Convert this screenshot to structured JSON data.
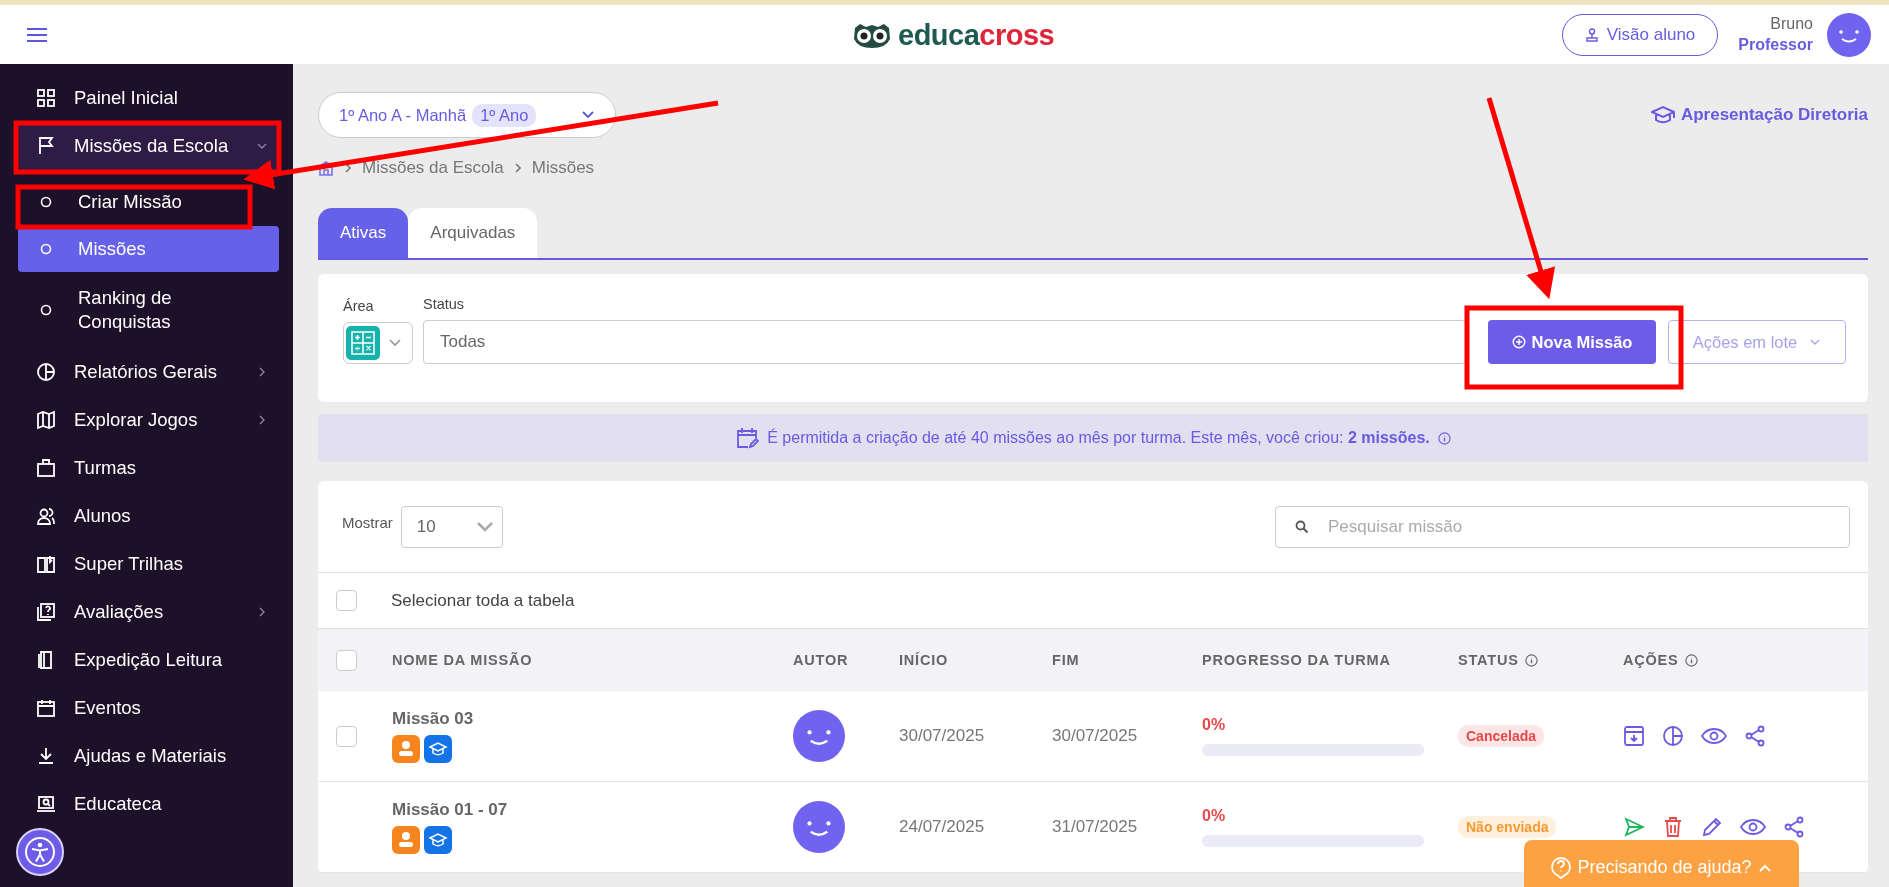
{
  "header": {
    "logo_prefix": "educa",
    "logo_suffix": "cross",
    "student_view": "Visão aluno",
    "user_name": "Bruno",
    "user_role": "Professor"
  },
  "sidebar": {
    "items": [
      {
        "label": "Painel Inicial",
        "kind": "item",
        "selected": false,
        "expanded": false,
        "has_submenu": false
      },
      {
        "label": "Missões da Escola",
        "kind": "item",
        "selected": false,
        "expanded": true,
        "has_submenu": true
      },
      {
        "label": "Criar Missão",
        "kind": "subitem",
        "selected": false,
        "expanded": false,
        "has_submenu": false
      },
      {
        "label": "Missões",
        "kind": "subitem",
        "selected": true,
        "expanded": false,
        "has_submenu": false
      },
      {
        "label": "Ranking de Conquistas",
        "kind": "subitem",
        "selected": false,
        "expanded": false,
        "has_submenu": false
      },
      {
        "label": "Relatórios Gerais",
        "kind": "item",
        "selected": false,
        "expanded": false,
        "has_submenu": true
      },
      {
        "label": "Explorar Jogos",
        "kind": "item",
        "selected": false,
        "expanded": false,
        "has_submenu": true
      },
      {
        "label": "Turmas",
        "kind": "item",
        "selected": false,
        "expanded": false,
        "has_submenu": false
      },
      {
        "label": "Alunos",
        "kind": "item",
        "selected": false,
        "expanded": false,
        "has_submenu": false
      },
      {
        "label": "Super Trilhas",
        "kind": "item",
        "selected": false,
        "expanded": false,
        "has_submenu": false
      },
      {
        "label": "Avaliações",
        "kind": "item",
        "selected": false,
        "expanded": false,
        "has_submenu": true
      },
      {
        "label": "Expedição Leitura",
        "kind": "item",
        "selected": false,
        "expanded": false,
        "has_submenu": false
      },
      {
        "label": "Eventos",
        "kind": "item",
        "selected": false,
        "expanded": false,
        "has_submenu": false
      },
      {
        "label": "Ajudas e Materiais",
        "kind": "item",
        "selected": false,
        "expanded": false,
        "has_submenu": false
      },
      {
        "label": "Educateca",
        "kind": "item",
        "selected": false,
        "expanded": false,
        "has_submenu": false
      }
    ]
  },
  "class_selector": {
    "value": "1º Ano A - Manhã",
    "badge": "1º Ano"
  },
  "presentation_link": "Apresentação Diretoria",
  "breadcrumb": [
    "Missões da Escola",
    "Missões"
  ],
  "tabs": [
    {
      "label": "Ativas",
      "selected": true
    },
    {
      "label": "Arquivadas",
      "selected": false
    }
  ],
  "filters": {
    "area_label": "Área",
    "status_label": "Status",
    "status_value": "Todas",
    "new_button": "Nova Missão",
    "bulk_actions": "Ações em lote"
  },
  "notice": {
    "text": "É permitida a criação de até 40 missões ao mês por turma. Este mês, você criou: **2 missões.**"
  },
  "table": {
    "show_label": "Mostrar",
    "page_size": "10",
    "search_placeholder": "Pesquisar missão",
    "select_all": "Selecionar toda a tabela",
    "select_all_checked": false,
    "header_checked": false,
    "columns": [
      {
        "label": "NOME DA MISSÃO",
        "info": false
      },
      {
        "label": "AUTOR",
        "info": false
      },
      {
        "label": "INÍCIO",
        "info": false
      },
      {
        "label": "FIM",
        "info": false
      },
      {
        "label": "PROGRESSO DA TURMA",
        "info": false
      },
      {
        "label": "STATUS",
        "info": true
      },
      {
        "label": "AÇÕES",
        "info": true
      }
    ],
    "rows": [
      {
        "name": "Missão 03",
        "checked": false,
        "start": "30/07/2025",
        "end": "30/07/2025",
        "progress": "0%",
        "level": 0,
        "status": {
          "text": "Cancelada",
          "kind": "cancelled"
        },
        "actions": [
          {
            "kind": "archive"
          },
          {
            "kind": "report"
          },
          {
            "kind": "view"
          },
          {
            "kind": "share"
          }
        ]
      },
      {
        "name": "Missão 01 - 07",
        "start": "24/07/2025",
        "end": "31/07/2025",
        "progress": "0%",
        "level": 0,
        "status": {
          "text": "Não enviada",
          "kind": "pending"
        },
        "actions": [
          {
            "kind": "send"
          },
          {
            "kind": "delete"
          },
          {
            "kind": "edit"
          },
          {
            "kind": "view"
          },
          {
            "kind": "share"
          }
        ]
      }
    ]
  },
  "help_button": "Precisando de ajuda?"
}
